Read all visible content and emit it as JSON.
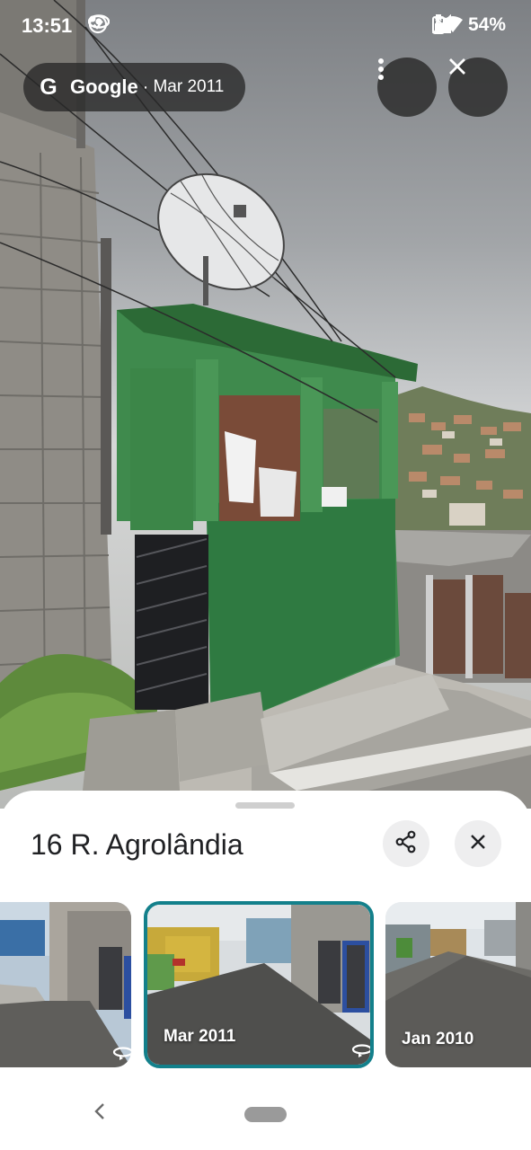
{
  "status_bar": {
    "time": "13:51",
    "battery_percent": "54%",
    "left_icons": [
      "eye-icon",
      "check-circle-icon",
      "dot-icon"
    ],
    "right_icons": [
      "bell-off-icon",
      "wifi-icon",
      "signal-icon",
      "signal-icon",
      "battery-icon"
    ]
  },
  "street_view": {
    "provider": "Google",
    "separator": "·",
    "capture_date": "Mar 2011",
    "more_button_icon": "more-vert-icon",
    "close_button_icon": "close-icon"
  },
  "sheet": {
    "title": "16 R. Agrolândia",
    "share_icon": "share-icon",
    "close_icon": "close-icon",
    "thumbnails": [
      {
        "label": "",
        "selected": false,
        "badge_icon": "360-icon"
      },
      {
        "label": "Mar 2011",
        "selected": true,
        "badge_icon": "360-icon"
      },
      {
        "label": "Jan 2010",
        "selected": false
      }
    ],
    "selected_border_color": "#13808b"
  },
  "nav_bar": {
    "back_icon": "back-chevron-icon",
    "home_icon": "home-pill-icon"
  }
}
